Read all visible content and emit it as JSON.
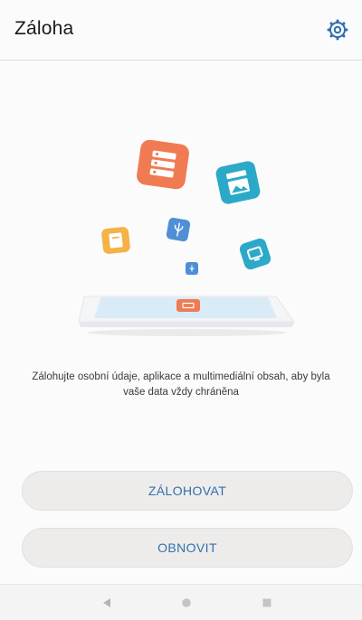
{
  "app_bar": {
    "title": "Záloha",
    "settings_icon": "gear-icon"
  },
  "illustration": {
    "icons": [
      "document-icon",
      "photos-icon",
      "notes-icon",
      "usb-icon",
      "usb-small-icon",
      "tv-icon",
      "phone-icon",
      "backup-icon"
    ],
    "colors": {
      "orange": "#f07b52",
      "teal": "#2ca9c8",
      "yellow": "#f5b247",
      "blue": "#4e8fd6",
      "phone_screen": "#d9ebf7"
    }
  },
  "description": "Zálohujte osobní údaje, aplikace a multimediální obsah, aby byla vaše data vždy chráněna",
  "actions": {
    "backup_label": "ZÁLOHOVAT",
    "restore_label": "OBNOVIT"
  },
  "navigation": {
    "back_icon": "back-triangle-icon",
    "home_icon": "home-circle-icon",
    "recent_icon": "recent-square-icon"
  },
  "colors": {
    "accent": "#2f6fb0",
    "background": "#fbfbfb",
    "button_bg": "#eeecea"
  }
}
